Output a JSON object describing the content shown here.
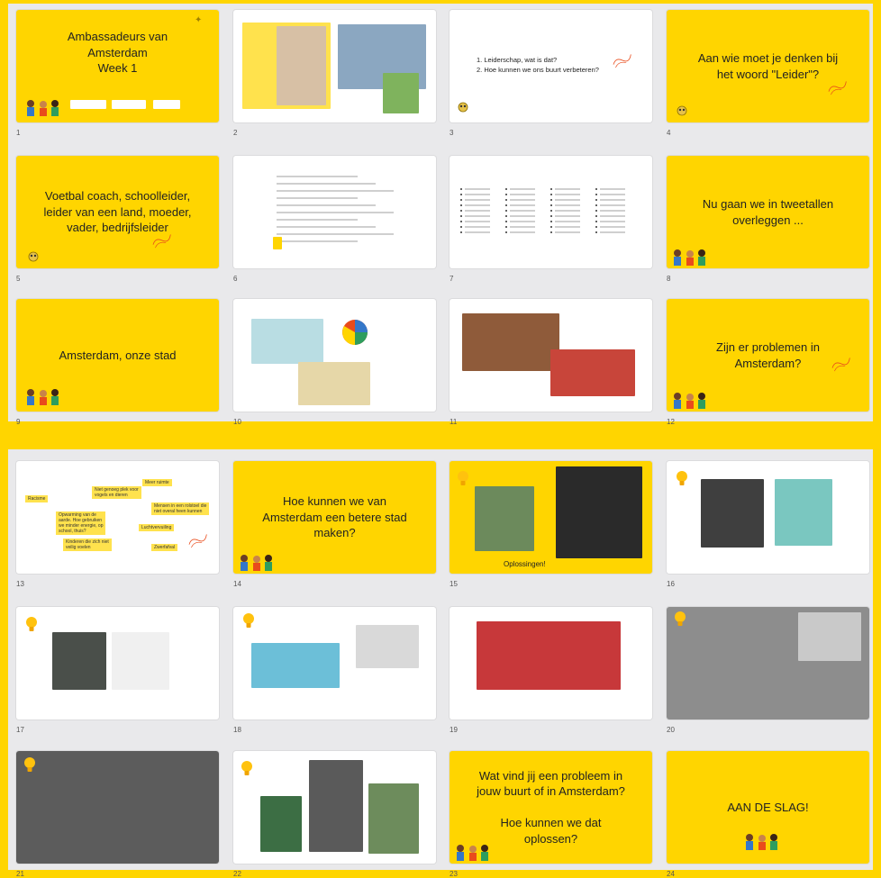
{
  "top_slides": [
    {
      "num": "1",
      "style": "yellow",
      "title": "Ambassadeurs van\nAmsterdam\nWeek 1"
    },
    {
      "num": "2",
      "style": "white",
      "title": ""
    },
    {
      "num": "3",
      "style": "white",
      "title": "",
      "list": [
        "1.   Leiderschap, wat is dat?",
        "2.   Hoe kunnen we ons buurt verbeteren?"
      ]
    },
    {
      "num": "4",
      "style": "yellow",
      "title": "Aan wie moet je denken bij\nhet woord \"Leider\"?"
    },
    {
      "num": "5",
      "style": "yellow",
      "title": "Voetbal coach, schoolleider,\nleider van een land, moeder,\nvader, bedrijfsleider"
    },
    {
      "num": "6",
      "style": "white",
      "title": ""
    },
    {
      "num": "7",
      "style": "white",
      "title": ""
    },
    {
      "num": "8",
      "style": "yellow",
      "title": "Nu gaan we in tweetallen\noverleggen ..."
    },
    {
      "num": "9",
      "style": "yellow",
      "title": "Amsterdam, onze stad"
    },
    {
      "num": "10",
      "style": "white",
      "title": ""
    },
    {
      "num": "11",
      "style": "white",
      "title": ""
    },
    {
      "num": "12",
      "style": "yellow",
      "title": "Zijn er problemen in\nAmsterdam?"
    }
  ],
  "bottom_slides": [
    {
      "num": "13",
      "style": "white",
      "title": ""
    },
    {
      "num": "14",
      "style": "yellow",
      "title": "Hoe kunnen we van\nAmsterdam een betere stad\nmaken?"
    },
    {
      "num": "15",
      "style": "yellow",
      "title": "",
      "caption": "Oplossingen!"
    },
    {
      "num": "16",
      "style": "white",
      "title": ""
    },
    {
      "num": "17",
      "style": "white",
      "title": ""
    },
    {
      "num": "18",
      "style": "white",
      "title": ""
    },
    {
      "num": "19",
      "style": "white",
      "title": ""
    },
    {
      "num": "20",
      "style": "white",
      "title": ""
    },
    {
      "num": "21",
      "style": "white",
      "title": ""
    },
    {
      "num": "22",
      "style": "white",
      "title": ""
    },
    {
      "num": "23",
      "style": "yellow",
      "title": "Wat vind jij een probleem in\njouw buurt of in Amsterdam?\n\nHoe kunnen we dat\noplossen?"
    },
    {
      "num": "24",
      "style": "yellow",
      "title": "AAN DE SLAG!"
    }
  ],
  "slide13_chips": [
    "Meer ruimte",
    "Niet genoeg plek voor\nvogels en dieren",
    "Racisme",
    "Mensen in een rolstoel die\nniet overal heen kunnen",
    "Opwarming van de\naarde. Hoe gebruiken\nwe minder energie, op\nschool, thuis?",
    "Luchtvervuiling",
    "Kinderen die zich niet\nveilig voelen",
    "Zwerfafval"
  ],
  "colors": {
    "accent": "#FFD500",
    "orange": "#E94B1B",
    "panel": "#E9E9EB"
  }
}
